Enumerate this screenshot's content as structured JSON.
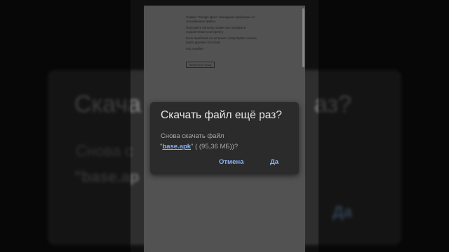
{
  "background": {
    "title": "Скача",
    "title_right": "аз?",
    "body": "Снова с",
    "link": "\"base.ap",
    "yes": "Да"
  },
  "page": {
    "line1": "Сервис \"Google Диск\" обнаружил проблемы со скачиванием файла",
    "line2": "Повторите попытку позже или проверьте подключение к интернету",
    "line3": "Если проблема не исчезнет, попробуйте скачать файл другим способом",
    "line4": "Код ошибки",
    "button": "Вернуться назад"
  },
  "dialog": {
    "title": "Скачать файл ещё раз?",
    "message_line1": "Снова скачать файл",
    "filename": "base.apk",
    "size": "( (95,36 МБ))?",
    "cancel_label": "Отмена",
    "ok_label": "Да",
    "accent_color": "#8ab4f8"
  }
}
